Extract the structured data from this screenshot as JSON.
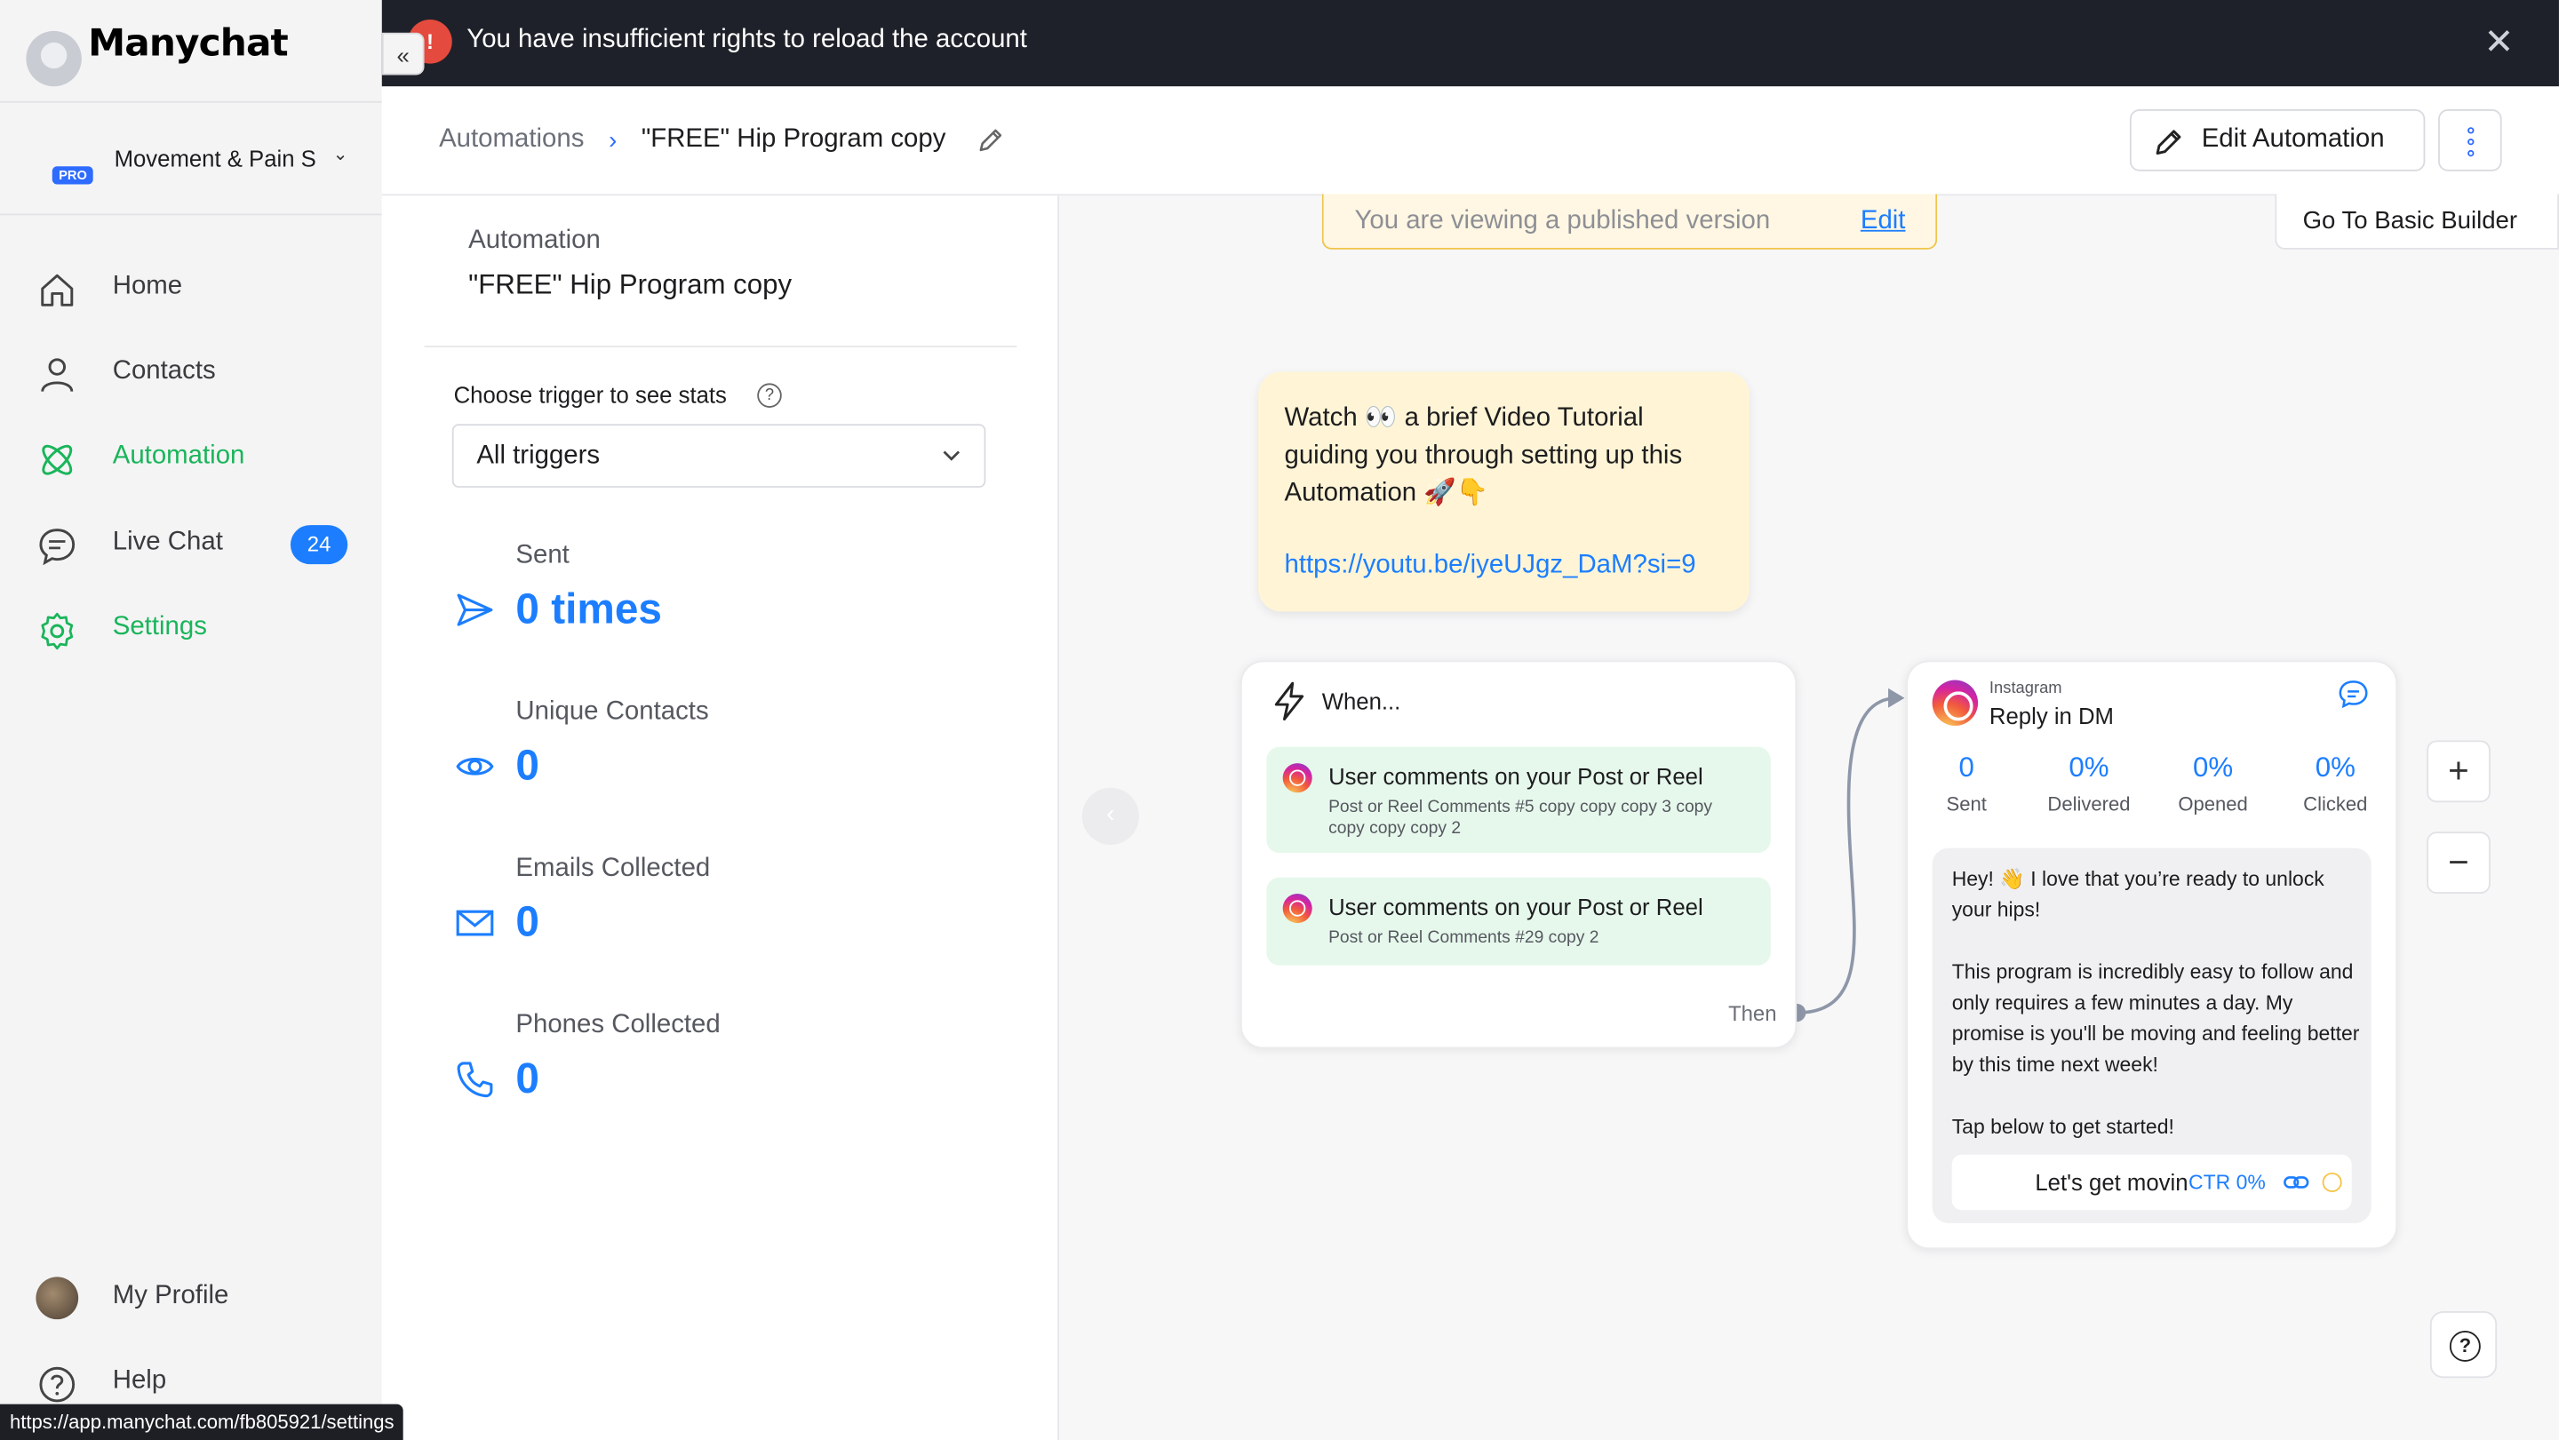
{
  "app": {
    "logo": "Manychat"
  },
  "account": {
    "name": "Movement & Pain S",
    "badge": "PRO"
  },
  "nav": {
    "home": "Home",
    "contacts": "Contacts",
    "automation": "Automation",
    "live_chat": "Live Chat",
    "live_chat_count": "24",
    "settings": "Settings",
    "my_profile": "My Profile",
    "help": "Help"
  },
  "banner": {
    "message": "You have insufficient rights to reload the account"
  },
  "breadcrumb": {
    "parent": "Automations",
    "current": "\"FREE\" Hip Program copy"
  },
  "toolbar": {
    "edit_automation": "Edit Automation"
  },
  "panel": {
    "subtitle": "Automation",
    "title": "\"FREE\" Hip Program copy",
    "trigger_label": "Choose trigger to see stats",
    "trigger_help": "?",
    "trigger_select": "All triggers",
    "stats": [
      {
        "label": "Sent",
        "value": "0 times"
      },
      {
        "label": "Unique Contacts",
        "value": "0"
      },
      {
        "label": "Emails Collected",
        "value": "0"
      },
      {
        "label": "Phones Collected",
        "value": "0"
      }
    ]
  },
  "canvas": {
    "published_notice": "You are viewing a published version",
    "published_edit": "Edit",
    "basic_builder": "Go To Basic Builder",
    "note_text": "Watch 👀 a brief Video Tutorial guiding you through setting up this Automation 🚀👇",
    "note_url": "https://youtu.be/iyeUJgz_DaM?si=9",
    "when_label": "When...",
    "triggers": [
      {
        "title": "User comments on your Post or Reel",
        "detail": "Post or Reel Comments #5 copy copy copy 3 copy copy copy copy 2"
      },
      {
        "title": "User comments on your Post or Reel",
        "detail": "Post or Reel Comments #29 copy 2"
      }
    ],
    "then_label": "Then",
    "dm": {
      "platform": "Instagram",
      "title": "Reply in DM",
      "metrics": [
        {
          "value": "0",
          "label": "Sent"
        },
        {
          "value": "0%",
          "label": "Delivered"
        },
        {
          "value": "0%",
          "label": "Opened"
        },
        {
          "value": "0%",
          "label": "Clicked"
        }
      ],
      "message": "Hey! 👋 I love that you’re ready to unlock your hips!\n\nThis program is incredibly easy to follow and only requires a few minutes a day. My promise is you'll be moving and feeling better by this time next week!\n\nTap below to get started!",
      "button_label": "Let's get moving",
      "button_ctr": "CTR 0%"
    },
    "zoom_in": "+",
    "zoom_out": "−",
    "help_icon": "?"
  },
  "status_url": "https://app.manychat.com/fb805921/settings",
  "colors": {
    "accent": "#1c7eff",
    "green": "#1ab55a",
    "banner_bg": "#1e2129",
    "warning": "#e44a3d"
  }
}
